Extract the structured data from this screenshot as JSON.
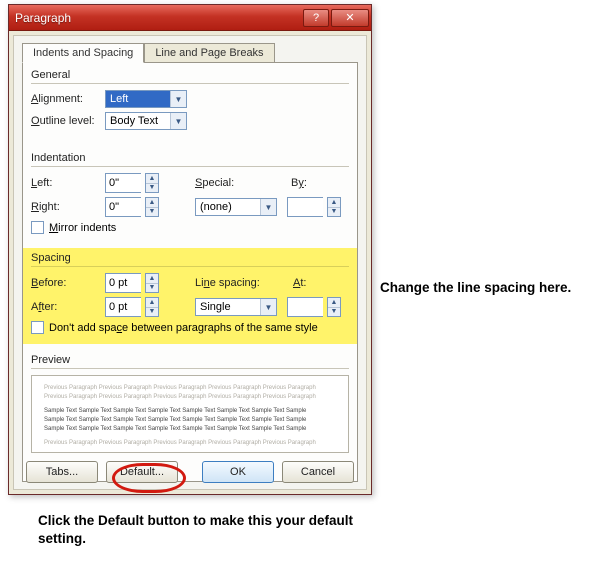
{
  "window": {
    "title": "Paragraph",
    "help_icon": "?",
    "close_icon": "✕"
  },
  "tabs": {
    "active": "Indents and Spacing",
    "inactive": "Line and Page Breaks"
  },
  "general": {
    "label": "General",
    "alignment_label": "Alignment:",
    "alignment_value": "Left",
    "outline_label": "Outline level:",
    "outline_value": "Body Text"
  },
  "indentation": {
    "label": "Indentation",
    "left_label": "Left:",
    "left_value": "0\"",
    "right_label": "Right:",
    "right_value": "0\"",
    "special_label": "Special:",
    "special_value": "(none)",
    "by_label": "By:",
    "by_value": "",
    "mirror_label": "Mirror indents"
  },
  "spacing": {
    "label": "Spacing",
    "before_label": "Before:",
    "before_value": "0 pt",
    "after_label": "After:",
    "after_value": "0 pt",
    "line_label": "Line spacing:",
    "line_value": "Single",
    "at_label": "At:",
    "at_value": "",
    "noadd_label": "Don't add space between paragraphs of the same style"
  },
  "preview": {
    "label": "Preview",
    "filler_light": "Previous Paragraph Previous Paragraph Previous Paragraph Previous Paragraph Previous Paragraph",
    "filler_dark": "Sample Text Sample Text Sample Text Sample Text Sample Text Sample Text Sample Text Sample"
  },
  "buttons": {
    "tabs": "Tabs...",
    "default": "Default...",
    "ok": "OK",
    "cancel": "Cancel"
  },
  "annotations": {
    "right": "Change the line spacing here.",
    "bottom": "Click the Default button to make this your default setting."
  }
}
